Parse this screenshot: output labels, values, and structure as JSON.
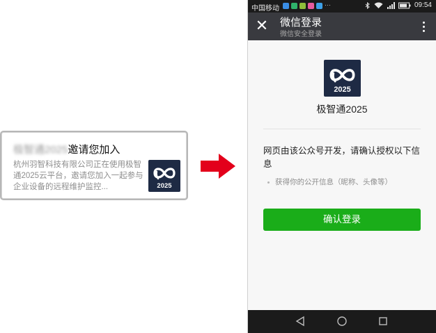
{
  "invite_card": {
    "title_blurred": "极智通2025",
    "title_text": "邀请您加入",
    "description": "杭州羽智科技有限公司正在使用极智通2025云平台，邀请您加入一起参与企业设备的远程维护监控...",
    "logo_text": "2025"
  },
  "colors": {
    "arrow": "#e3001b",
    "logo_bg": "#1e2a44",
    "titlebar_bg": "#393a3f",
    "confirm_bg": "#1aad19",
    "status_bg": "#1b1b1b"
  },
  "phone": {
    "statusbar": {
      "carrier": "中国移动",
      "app_icons": [
        "#3a8ee6",
        "#2fb36b",
        "#8fbf3a",
        "#e85b9e",
        "#3da0e8"
      ],
      "time": "09:54"
    },
    "titlebar": {
      "close_icon": "close-icon",
      "title": "微信登录",
      "subtitle": "微信安全登录",
      "more_icon": "more-vertical-icon"
    },
    "app": {
      "logo_text": "2025",
      "name": "极智通2025"
    },
    "auth": {
      "heading": "网页由该公众号开发，请确认授权以下信息",
      "permissions": [
        "获得你的公开信息（昵称、头像等）"
      ]
    },
    "confirm_button": "确认登录",
    "navbar": {
      "icons": [
        "back-icon",
        "home-icon",
        "recent-apps-icon"
      ]
    }
  }
}
